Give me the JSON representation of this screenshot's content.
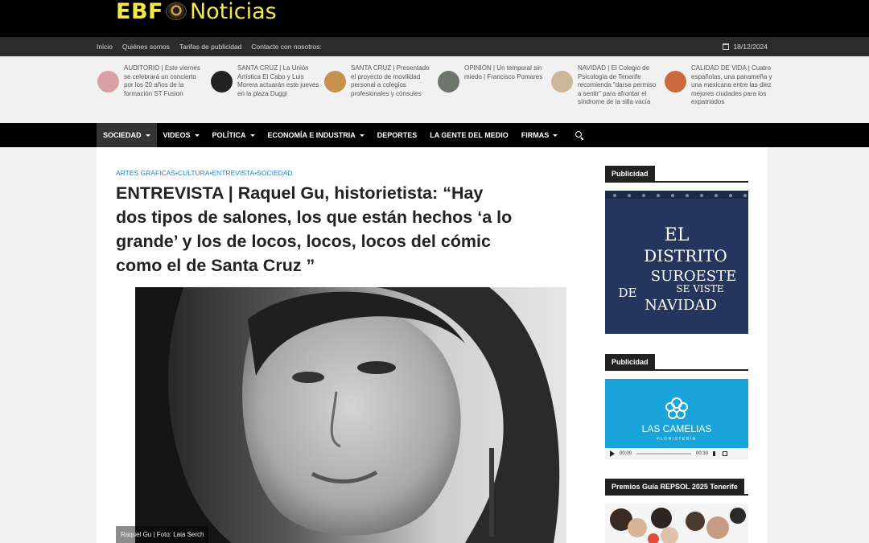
{
  "header": {
    "logo_left": "EBF",
    "logo_right": "Noticias"
  },
  "topbar": {
    "links": [
      "Inicio",
      "Quiénes somos",
      "Tarifas de publicidad",
      "Contacte con nosotros:"
    ],
    "date": "18/12/2024"
  },
  "ticker": [
    {
      "text": "AUDITORIO | Este viernes se celebrará un concierto por los 20 años de la formación ST Fusion",
      "thumb": "#d9a0a6"
    },
    {
      "text": "SANTA CRUZ | La Unión Artística El Cabo y Luis Morera actuarán este jueves en la plaza Duggi",
      "thumb": "#222222"
    },
    {
      "text": "SANTA CRUZ | Presentado el proyecto de movilidad personal a colegios profesionales y cónsules",
      "thumb": "#c7924e"
    },
    {
      "text": "OPINIÓN | Un temporal sin miedo | Francisco Pomares",
      "thumb": "#6d756d"
    },
    {
      "text": "NAVIDAD | El Colegio de Psicología de Tenerife recomienda “darse permiso a sentir” para afrontar el síndrome de la silla vacía",
      "thumb": "#cdb79a"
    },
    {
      "text": "CALIDAD DE VIDA | Cuatro españolas, una panameña y una mexicana entre las diez mejores ciudades para los expatriados",
      "thumb": "#c96b3c"
    }
  ],
  "nav": {
    "items": [
      {
        "label": "SOCIEDAD",
        "has_caret": true,
        "active": true
      },
      {
        "label": "VIDEOS",
        "has_caret": true,
        "active": false
      },
      {
        "label": "POLÍTICA",
        "has_caret": true,
        "active": false
      },
      {
        "label": "ECONOMÍA E INDUSTRIA",
        "has_caret": true,
        "active": false
      },
      {
        "label": "DEPORTES",
        "has_caret": false,
        "active": false
      },
      {
        "label": "LA GENTE DEL MEDIO",
        "has_caret": false,
        "active": false
      },
      {
        "label": "FIRMAS",
        "has_caret": true,
        "active": false
      }
    ],
    "search_icon": "search-icon"
  },
  "article": {
    "categories": "ARTES GRÁFICAS•CULTURA•ENTREVISTA•SOCIEDAD",
    "title": "ENTREVISTA | Raquel Gu, historietista: “Hay dos tipos de salones, los que están hechos ‘a lo grande’ y los de locos, locos, locos del cómic como el de Santa Cruz ”",
    "caption": "Raquel Gu | Foto: Laia Serch"
  },
  "sidebar": {
    "widget1_title": "Publicidad",
    "ad1_lines": [
      "EL",
      "DISTRITO",
      "SUROESTE",
      "DE",
      "SE VISTE",
      "NAVIDAD"
    ],
    "widget2_title": "Publicidad",
    "ad2_brand": "LAS CAMELIAS",
    "ad2_sub": "FLORISTERÍA",
    "player": {
      "current": "00:00",
      "total": "00:30"
    },
    "widget3_title": "Premios Guía REPSOL 2025 Tenerife"
  },
  "colors": {
    "logo_yellow": "#f5e94a",
    "category_blue": "#1e88c8",
    "ad_navy": "#24355e",
    "ad_cyan": "#1aa3d8"
  }
}
